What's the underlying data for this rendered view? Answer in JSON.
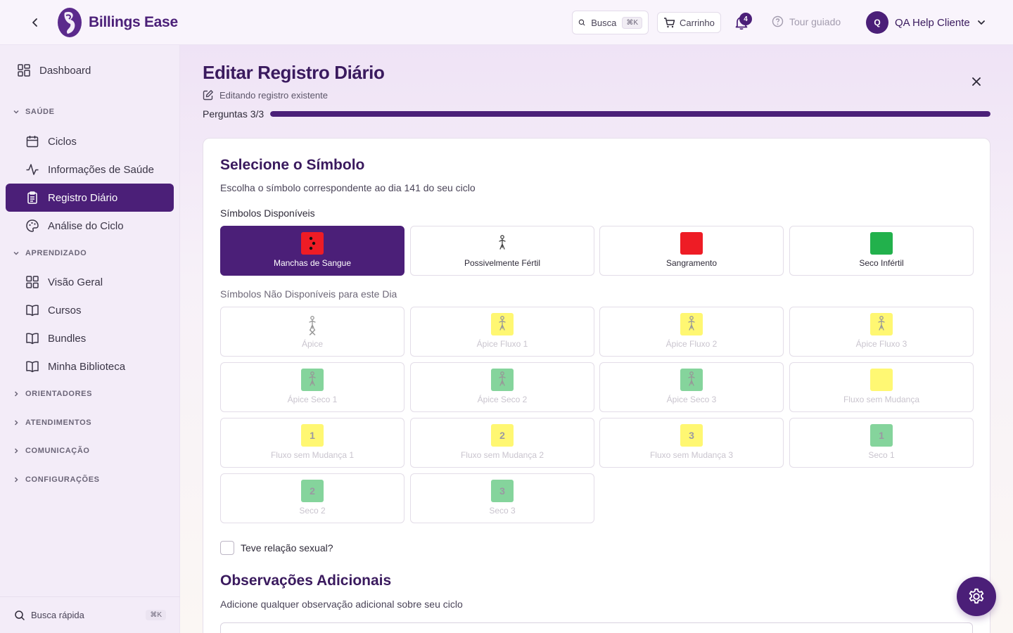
{
  "app": {
    "name": "Billings Ease"
  },
  "topbar": {
    "search_label": "Busca",
    "search_kbd": "⌘K",
    "cart_label": "Carrinho",
    "notifications_count": "4",
    "tour_label": "Tour guiado",
    "user_initial": "Q",
    "user_name": "QA Help Cliente"
  },
  "sidebar": {
    "dashboard": "Dashboard",
    "sections": {
      "saude": "SAÚDE",
      "aprendizado": "APRENDIZADO",
      "orientadores": "ORIENTADORES",
      "atendimentos": "ATENDIMENTOS",
      "comunicacao": "COMUNICAÇÃO",
      "configuracoes": "CONFIGURAÇÕES"
    },
    "saude_items": [
      "Ciclos",
      "Informações de Saúde",
      "Registro Diário",
      "Análise do Ciclo"
    ],
    "aprendizado_items": [
      "Visão Geral",
      "Cursos",
      "Bundles",
      "Minha Biblioteca"
    ],
    "quick_search": "Busca rápida",
    "quick_search_kbd": "⌘K"
  },
  "page": {
    "title": "Editar Registro Diário",
    "subtitle": "Editando registro existente",
    "progress_label": "Perguntas 3/3",
    "progress_value": 1.0
  },
  "symbol_card": {
    "title": "Selecione o Símbolo",
    "subtitle": "Escolha o símbolo correspondente ao dia 141 do seu ciclo",
    "available_label": "Símbolos Disponíveis",
    "unavailable_label": "Símbolos Não Disponíveis para este Dia",
    "available": [
      {
        "label": "Manchas de Sangue",
        "icon": "blood-spots-icon",
        "color": "#ee1c25",
        "selected": true
      },
      {
        "label": "Possivelmente Fértil",
        "icon": "fertile-figure-icon",
        "color": "#ffffff",
        "selected": false
      },
      {
        "label": "Sangramento",
        "icon": "bleeding-icon",
        "color": "#ee1c25",
        "selected": false
      },
      {
        "label": "Seco Infértil",
        "icon": "dry-infertile-icon",
        "color": "#22b14c",
        "selected": false
      }
    ],
    "unavailable": [
      {
        "label": "Ápice",
        "icon": "peak-x-icon",
        "color": "#ffffff",
        "glyph": ""
      },
      {
        "label": "Ápice Fluxo 1",
        "icon": "peak-flow-1-icon",
        "color": "#fff200",
        "glyph": ""
      },
      {
        "label": "Ápice Fluxo 2",
        "icon": "peak-flow-2-icon",
        "color": "#fff200",
        "glyph": ""
      },
      {
        "label": "Ápice Fluxo 3",
        "icon": "peak-flow-3-icon",
        "color": "#fff200",
        "glyph": ""
      },
      {
        "label": "Ápice Seco 1",
        "icon": "peak-dry-1-icon",
        "color": "#22b14c",
        "glyph": ""
      },
      {
        "label": "Ápice Seco 2",
        "icon": "peak-dry-2-icon",
        "color": "#22b14c",
        "glyph": ""
      },
      {
        "label": "Ápice Seco 3",
        "icon": "peak-dry-3-icon",
        "color": "#22b14c",
        "glyph": ""
      },
      {
        "label": "Fluxo sem Mudança",
        "icon": "flow-no-change-icon",
        "color": "#fff200",
        "glyph": ""
      },
      {
        "label": "Fluxo sem Mudança 1",
        "icon": "flow-no-change-1-icon",
        "color": "#fff200",
        "glyph": "1"
      },
      {
        "label": "Fluxo sem Mudança 2",
        "icon": "flow-no-change-2-icon",
        "color": "#fff200",
        "glyph": "2"
      },
      {
        "label": "Fluxo sem Mudança 3",
        "icon": "flow-no-change-3-icon",
        "color": "#fff200",
        "glyph": "3"
      },
      {
        "label": "Seco 1",
        "icon": "dry-1-icon",
        "color": "#22b14c",
        "glyph": "1"
      },
      {
        "label": "Seco 2",
        "icon": "dry-2-icon",
        "color": "#22b14c",
        "glyph": "2"
      },
      {
        "label": "Seco 3",
        "icon": "dry-3-icon",
        "color": "#22b14c",
        "glyph": "3"
      }
    ],
    "checkbox_label": "Teve relação sexual?"
  },
  "observations": {
    "title": "Observações Adicionais",
    "subtitle": "Adicione qualquer observação adicional sobre seu ciclo"
  }
}
